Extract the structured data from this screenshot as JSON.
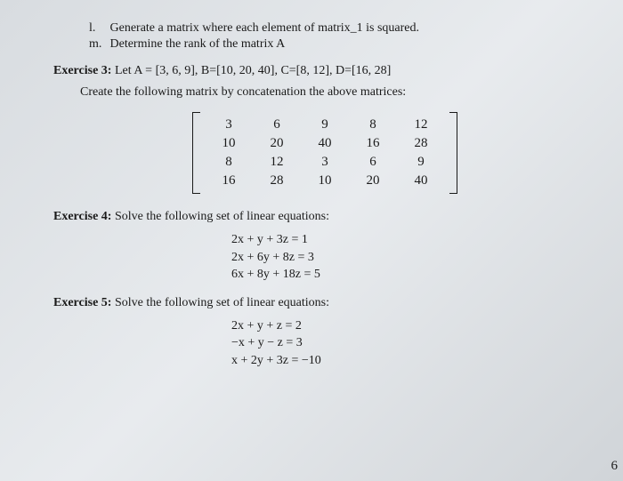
{
  "top_partial": "",
  "items": {
    "l": {
      "marker": "l.",
      "text": "Generate a matrix where each element of matrix_1 is squared."
    },
    "m": {
      "marker": "m.",
      "text": "Determine the rank of the matrix A"
    }
  },
  "ex3": {
    "label": "Exercise 3:",
    "text": " Let A = [3, 6, 9], B=[10, 20, 40], C=[8, 12], D=[16, 28]",
    "sub": "Create the following matrix by concatenation the above matrices:"
  },
  "matrix": {
    "rows": [
      [
        "3",
        "6",
        "9",
        "8",
        "12"
      ],
      [
        "10",
        "20",
        "40",
        "16",
        "28"
      ],
      [
        "8",
        "12",
        "3",
        "6",
        "9"
      ],
      [
        "16",
        "28",
        "10",
        "20",
        "40"
      ]
    ]
  },
  "ex4": {
    "label": "Exercise 4:",
    "text": " Solve the following set of linear equations:",
    "eqs": [
      "2x + y + 3z = 1",
      "2x + 6y + 8z = 3",
      "6x + 8y + 18z = 5"
    ]
  },
  "ex5": {
    "label": "Exercise 5:",
    "text": " Solve the following set of linear equations:",
    "eqs": [
      "2x + y + z = 2",
      "−x + y − z = 3",
      "x + 2y + 3z = −10"
    ]
  },
  "page_number": "6"
}
